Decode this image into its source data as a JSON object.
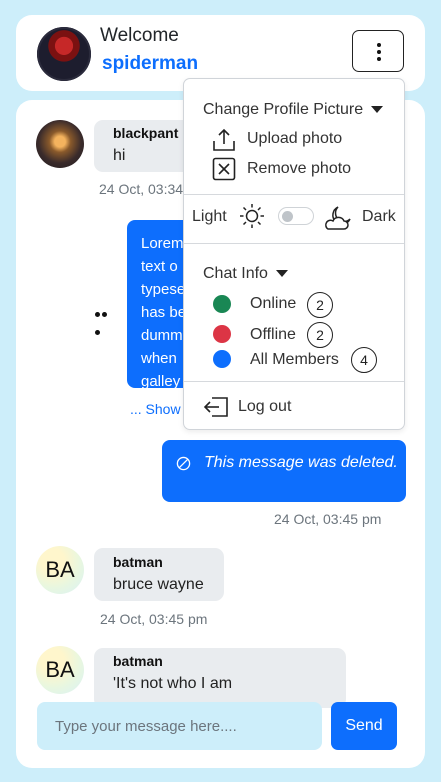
{
  "header": {
    "greeting": "Welcome",
    "username": "spiderman"
  },
  "messages": [
    {
      "sender": "blackpant",
      "text": "hi",
      "time": "24 Oct, 03:34"
    },
    {
      "type": "own",
      "text_lines": [
        "Lorem",
        "text o",
        "typese",
        "has be",
        "dumm",
        "when",
        "galley"
      ],
      "show_more": "... Show"
    },
    {
      "type": "own-deleted",
      "text": "This message was deleted.",
      "time": "24 Oct, 03:45 pm"
    },
    {
      "sender": "batman",
      "initials": "BA",
      "text": "bruce wayne",
      "time": "24 Oct, 03:45 pm"
    },
    {
      "sender": "batman",
      "initials": "BA",
      "text": "'It's not who I am"
    }
  ],
  "composer": {
    "placeholder": "Type your message here....",
    "send_label": "Send"
  },
  "dropdown": {
    "profile_section": "Change Profile Picture",
    "upload": "Upload photo",
    "remove": "Remove photo",
    "theme_light": "Light",
    "theme_dark": "Dark",
    "chat_info": "Chat Info",
    "online_label": "Online",
    "online_count": "2",
    "offline_label": "Offline",
    "offline_count": "2",
    "all_label": "All Members",
    "all_count": "4",
    "logout": "Log out"
  },
  "colors": {
    "accent": "#0d6efd",
    "online": "#198754",
    "offline": "#dc3545",
    "all": "#0d6efd",
    "background": "#cdeefa"
  }
}
